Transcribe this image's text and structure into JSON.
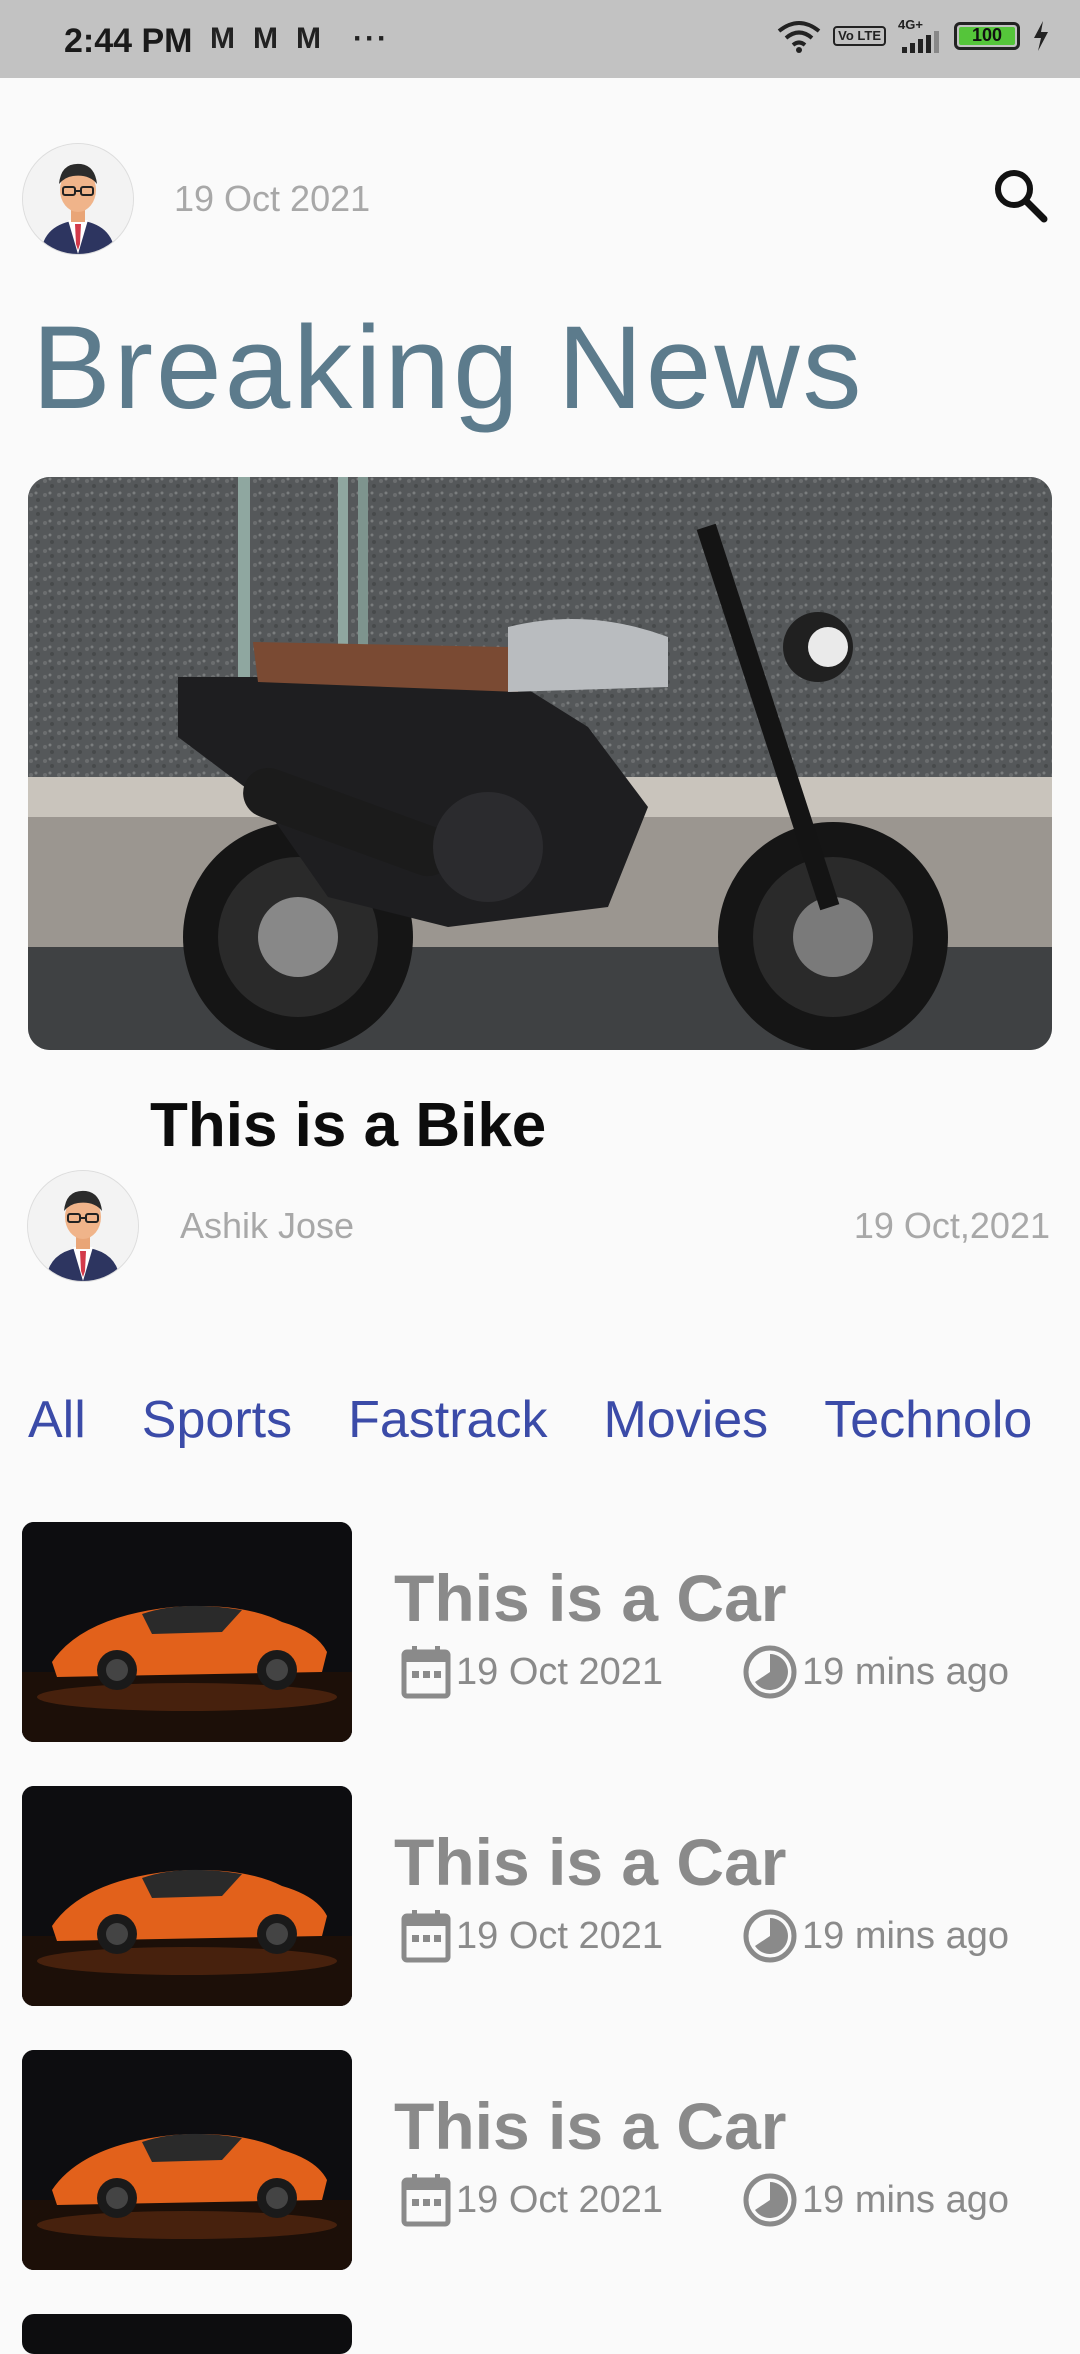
{
  "status_bar": {
    "time": "2:44 PM",
    "notifications": [
      "M",
      "M",
      "M"
    ],
    "more": "···",
    "network": "4G+",
    "volte": "Vo LTE",
    "battery": "100"
  },
  "header": {
    "date": "19 Oct 2021",
    "avatar_icon": "user-avatar-icon",
    "search_icon": "search-icon"
  },
  "page_title": "Breaking News",
  "featured": {
    "caption": "This is a Bike",
    "author": "Ashik Jose",
    "date": "19 Oct,2021"
  },
  "tabs": [
    "All",
    "Sports",
    "Fastrack",
    "Movies",
    "Technolo"
  ],
  "articles": [
    {
      "title": "This is a Car",
      "date": "19 Oct 2021",
      "time": "19 mins ago"
    },
    {
      "title": "This is a Car",
      "date": "19 Oct 2021",
      "time": "19 mins ago"
    },
    {
      "title": "This is a Car",
      "date": "19 Oct 2021",
      "time": "19 mins ago"
    }
  ],
  "colors": {
    "title": "#5c7b8c",
    "tab": "#3b4ba8",
    "muted": "#a8a8a8",
    "article_text": "#8a8a8a"
  }
}
